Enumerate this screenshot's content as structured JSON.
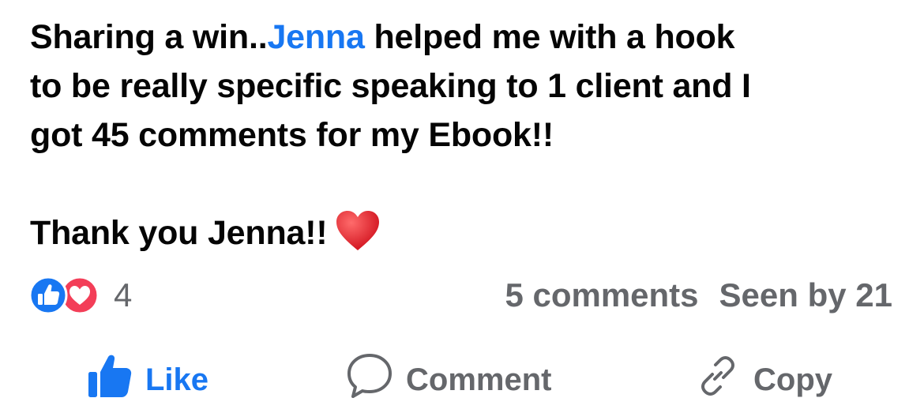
{
  "post": {
    "line1_before": "Sharing a win..",
    "mention": "Jenna",
    "line1_after": " helped me with a hook",
    "line2": "to be really specific speaking to 1 client and I",
    "line3": "got 45 comments for my Ebook!!",
    "thanks": "Thank you Jenna!!"
  },
  "stats": {
    "reaction_icons": [
      "like-reaction-icon",
      "love-reaction-icon"
    ],
    "reaction_count": "4",
    "comments": "5 comments",
    "seen": "Seen by 21"
  },
  "actions": {
    "like": "Like",
    "comment": "Comment",
    "copy": "Copy"
  },
  "colors": {
    "accent": "#1877f2",
    "muted": "#65676b",
    "love": "#f33e58",
    "text": "#050505"
  }
}
